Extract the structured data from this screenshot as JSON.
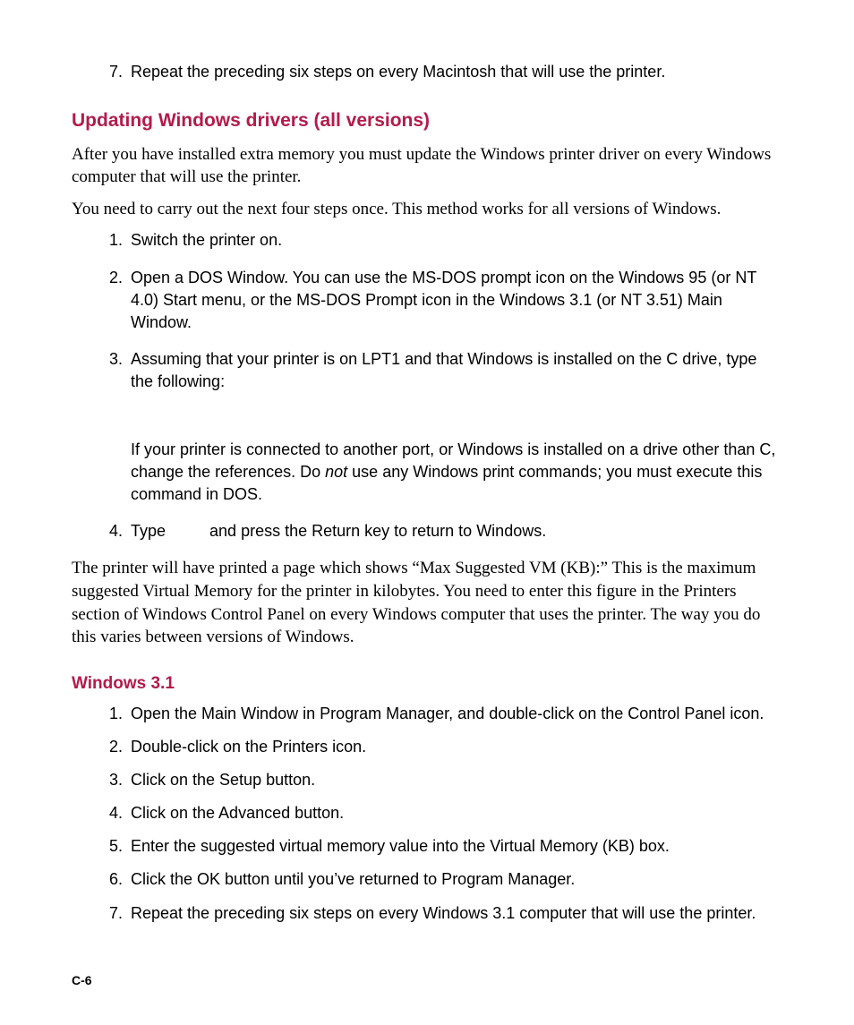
{
  "topList": {
    "start": 7,
    "items": [
      "Repeat the preceding six steps on every Macintosh that will use the printer."
    ]
  },
  "heading1": "Updating Windows drivers (all versions)",
  "para1": "After you have installed extra memory you must update the Windows printer driver on every Windows computer that will use the printer.",
  "para2": "You need to carry out the next four steps once. This method works for all versions of Windows.",
  "steps1": {
    "items": [
      {
        "text": "Switch the printer on."
      },
      {
        "text": "Open a DOS Window. You can use the MS-DOS prompt icon on the Windows 95 (or NT 4.0) Start menu, or the MS-DOS Prompt icon in the Windows 3.1 (or NT 3.51) Main Window."
      },
      {
        "text": "Assuming that your printer is on LPT1 and that Windows is installed on the C drive, type the following:",
        "sub_pre": "If your printer is connected to another port, or Windows is installed on a drive other than C, change the references. Do ",
        "sub_em": "not",
        "sub_post": " use any Windows print commands; you must execute this command in DOS."
      },
      {
        "pre": "Type",
        "post": " and press the Return key to return to Windows.",
        "gap": true
      }
    ]
  },
  "para3": "The printer will have printed a page which shows “Max Suggested VM (KB):” This is the maximum suggested Virtual Memory for the printer in kilobytes. You need to enter this figure in the Printers section of Windows Control Panel on every Windows computer that uses the printer. The way you do this varies between versions of Windows.",
  "heading2": "Windows 3.1",
  "steps2": {
    "items": [
      "Open the Main Window in Program Manager, and double-click on the Control Panel icon.",
      "Double-click on the Printers icon.",
      "Click on the Setup button.",
      "Click on the Advanced button.",
      "Enter the suggested virtual memory value into the Virtual Memory (KB) box.",
      "Click the OK button until you’ve returned to Program Manager.",
      "Repeat the preceding six steps on every Windows 3.1 computer that will use the printer."
    ]
  },
  "footer": "C-6"
}
